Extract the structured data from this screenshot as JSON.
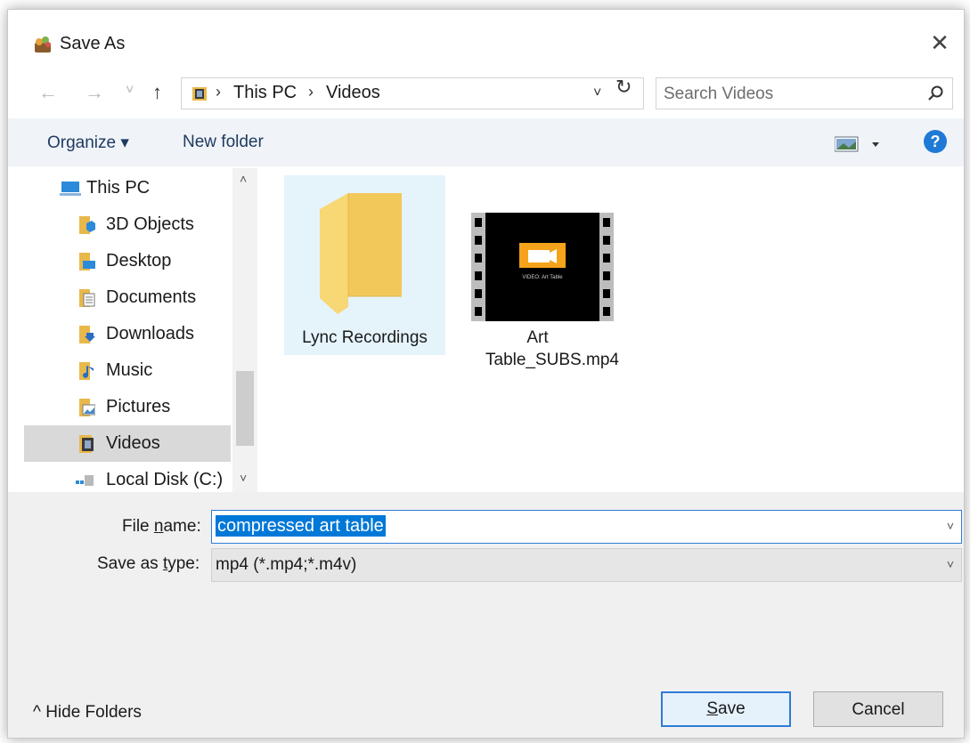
{
  "window": {
    "title": "Save As",
    "close_glyph": "✕"
  },
  "nav": {
    "back_glyph": "←",
    "forward_glyph": "→",
    "recent_glyph": "˅",
    "up_glyph": "↑",
    "breadcrumb": [
      "This PC",
      "Videos"
    ],
    "breadcrumb_sep": "›",
    "dropdown_glyph": "˅",
    "refresh_glyph": "↻",
    "search_placeholder": "Search Videos"
  },
  "toolbar": {
    "organize_label": "Organize ▾",
    "new_folder_label": "New folder",
    "help_glyph": "?"
  },
  "sidebar": {
    "items": [
      {
        "label": "This PC",
        "icon": "computer-icon"
      },
      {
        "label": "3D Objects",
        "icon": "3d-objects-folder-icon"
      },
      {
        "label": "Desktop",
        "icon": "desktop-folder-icon"
      },
      {
        "label": "Documents",
        "icon": "documents-folder-icon"
      },
      {
        "label": "Downloads",
        "icon": "downloads-folder-icon"
      },
      {
        "label": "Music",
        "icon": "music-folder-icon"
      },
      {
        "label": "Pictures",
        "icon": "pictures-folder-icon"
      },
      {
        "label": "Videos",
        "icon": "videos-folder-icon",
        "selected": true
      },
      {
        "label": "Local Disk (C:)",
        "icon": "drive-icon"
      }
    ],
    "scroll_up_glyph": "˄",
    "scroll_down_glyph": "˅"
  },
  "files": [
    {
      "name": "Lync Recordings",
      "type": "folder",
      "selected": true
    },
    {
      "name": "Art Table_SUBS.mp4",
      "type": "video",
      "thumb_caption": "VIDEO: Art Table"
    }
  ],
  "form": {
    "file_name_label_pre": "File ",
    "file_name_label_key": "n",
    "file_name_label_post": "ame:",
    "file_name_value": "compressed art table",
    "save_type_label_pre": "Save as ",
    "save_type_label_key": "t",
    "save_type_label_post": "ype:",
    "save_type_value": "mp4 (*.mp4;*.m4v)",
    "dropdown_glyph": "˅"
  },
  "footer": {
    "hide_folders_label": "^  Hide Folders",
    "save_key": "S",
    "save_rest": "ave",
    "cancel_label": "Cancel"
  },
  "colors": {
    "accent": "#0078d7",
    "command_bar": "#f0f4f9",
    "folder": "#f8d775"
  }
}
